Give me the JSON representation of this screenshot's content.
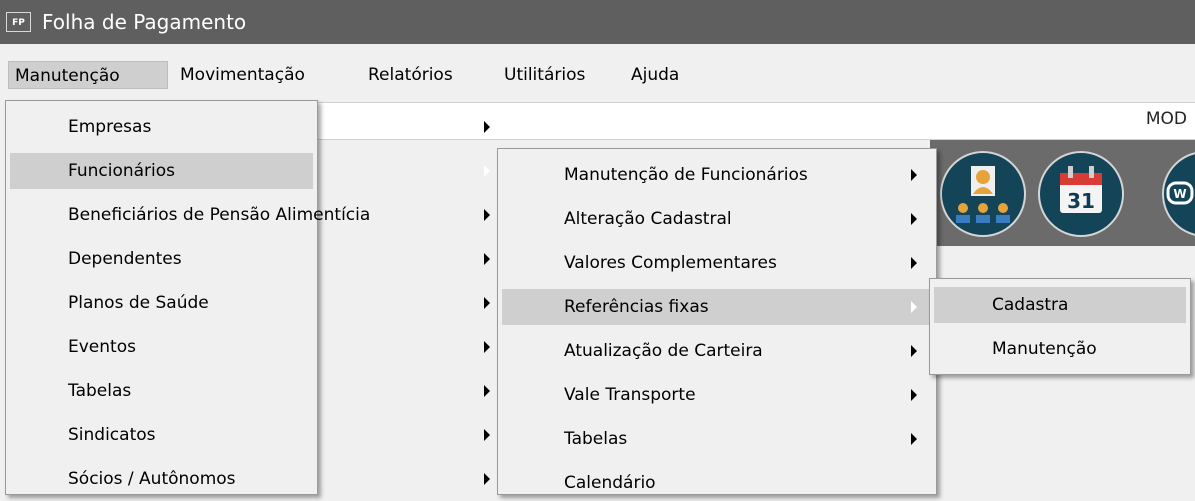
{
  "window": {
    "icon_text": "FP",
    "title": "Folha de Pagamento"
  },
  "menubar": {
    "items": [
      "Manutenção",
      "Movimentação",
      "Relatórios",
      "Utilitários",
      "Ajuda"
    ]
  },
  "content": {
    "mod_label": "MOD"
  },
  "toolbar": {
    "icons": [
      "person-group-icon",
      "calendar-icon",
      "w-app-icon"
    ],
    "calendar_day": "31"
  },
  "menu_manutencao": {
    "items": [
      {
        "label": "Empresas"
      },
      {
        "label": "Funcionários"
      },
      {
        "label": "Beneficiários de Pensão Alimentícia"
      },
      {
        "label": "Dependentes"
      },
      {
        "label": "Planos de Saúde"
      },
      {
        "label": "Eventos"
      },
      {
        "label": "Tabelas"
      },
      {
        "label": "Sindicatos"
      },
      {
        "label": "Sócios / Autônomos"
      }
    ]
  },
  "menu_funcionarios": {
    "items": [
      {
        "label": "Manutenção de Funcionários"
      },
      {
        "label": "Alteração Cadastral"
      },
      {
        "label": "Valores Complementares"
      },
      {
        "label": "Referências fixas"
      },
      {
        "label": "Atualização de Carteira"
      },
      {
        "label": "Vale Transporte"
      },
      {
        "label": "Tabelas"
      },
      {
        "label": "Calendário"
      }
    ]
  },
  "menu_referencias": {
    "items": [
      {
        "label": "Cadastra"
      },
      {
        "label": "Manutenção"
      }
    ]
  },
  "colors": {
    "titlebar": "#5f5f5f",
    "menu_bg": "#f0f0f0",
    "highlight": "#cfcfcf",
    "toolbar_icon": "#134458"
  }
}
